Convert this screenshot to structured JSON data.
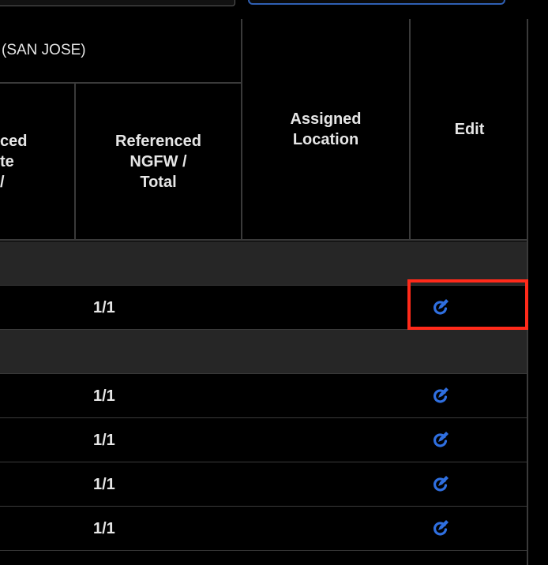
{
  "table": {
    "group_header": "(SAN JOSE)",
    "sub_left_header": "ced\nte\n/",
    "sub_ref_header": "Referenced\nNGFW /\nTotal",
    "assigned_header": "Assigned\nLocation",
    "edit_header": "Edit",
    "rows": [
      {
        "type": "group"
      },
      {
        "type": "data",
        "referenced": "1/1",
        "edit_icon": "edit-icon",
        "highlighted": true
      },
      {
        "type": "group"
      },
      {
        "type": "data",
        "referenced": "1/1",
        "edit_icon": "edit-icon"
      },
      {
        "type": "data",
        "referenced": "1/1",
        "edit_icon": "edit-icon"
      },
      {
        "type": "data",
        "referenced": "1/1",
        "edit_icon": "edit-icon"
      },
      {
        "type": "data",
        "referenced": "1/1",
        "edit_icon": "edit-icon"
      }
    ]
  },
  "colors": {
    "background": "#000000",
    "group_row": "#262626",
    "border": "#3a3a3a",
    "accent": "#2f6fe0",
    "highlight": "#ff2a1a"
  }
}
